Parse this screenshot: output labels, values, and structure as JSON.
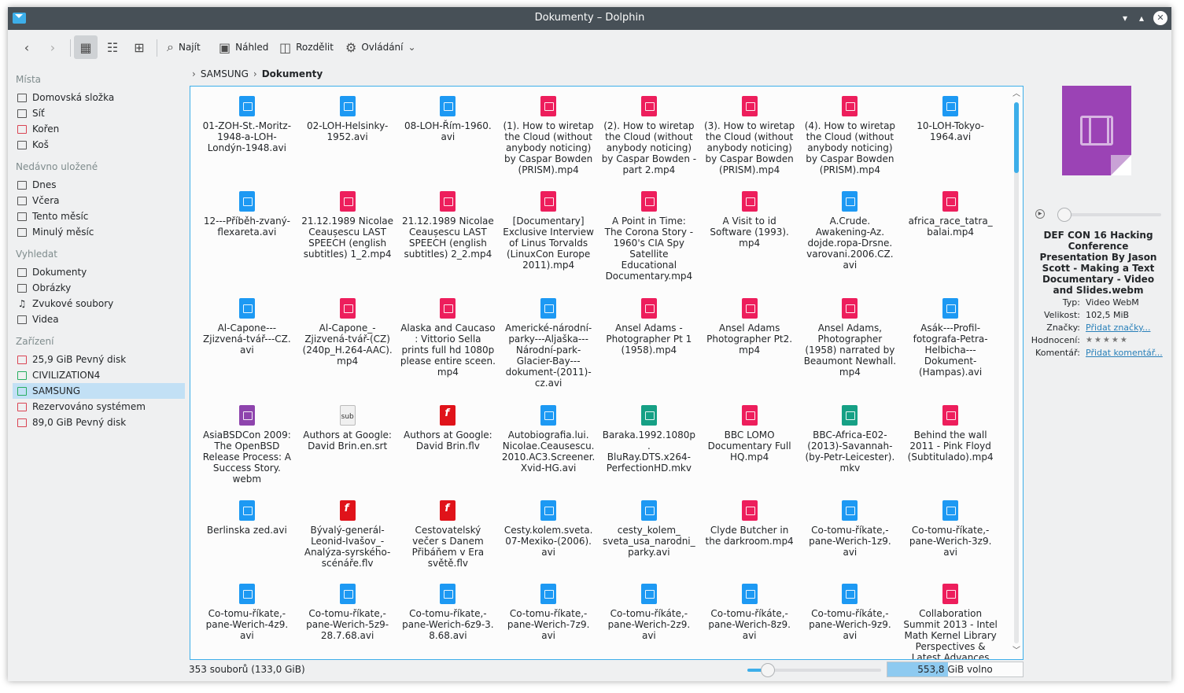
{
  "window": {
    "title": "Dokumenty – Dolphin"
  },
  "toolbar": {
    "find_label": "Najít",
    "preview_label": "Náhled",
    "split_label": "Rozdělit",
    "control_label": "Ovládání"
  },
  "sidebar": {
    "places_header": "Místa",
    "places": [
      "Domovská složka",
      "Síť",
      "Kořen",
      "Koš"
    ],
    "recent_header": "Nedávno uložené",
    "recent": [
      "Dnes",
      "Včera",
      "Tento měsíc",
      "Minulý měsíc"
    ],
    "search_header": "Vyhledat",
    "search": [
      "Dokumenty",
      "Obrázky",
      "Zvukové soubory",
      "Videa"
    ],
    "devices_header": "Zařízení",
    "devices": [
      "25,9 GiB Pevný disk",
      "CIVILIZATION4",
      "SAMSUNG",
      "Rezervováno systémem",
      "89,0 GiB Pevný disk"
    ]
  },
  "breadcrumb": {
    "root": "SAMSUNG",
    "current": "Dokumenty"
  },
  "files": [
    {
      "name": "01-ZOH-St.-Moritz-\n1948-a-LOH-\nLondýn-1948.avi",
      "color": "blue"
    },
    {
      "name": "02-LOH-Helsinky-\n1952.avi",
      "color": "blue"
    },
    {
      "name": "08-LOH-Řím-1960.\navi",
      "color": "blue"
    },
    {
      "name": "(1). How to wiretap\nthe Cloud (without\nanybody noticing)\nby Caspar Bowden\n(PRISM).mp4",
      "color": "red"
    },
    {
      "name": "(2). How to wiretap\nthe Cloud (without\nanybody noticing)\nby Caspar Bowden -\npart 2.mp4",
      "color": "red"
    },
    {
      "name": "(3). How to wiretap\nthe Cloud (without\nanybody noticing)\nby Caspar Bowden\n(PRISM).mp4",
      "color": "red"
    },
    {
      "name": "(4). How to wiretap\nthe Cloud (without\nanybody noticing)\nby Caspar Bowden\n(PRISM).mp4",
      "color": "red"
    },
    {
      "name": "10-LOH-Tokyo-\n1964.avi",
      "color": "blue"
    },
    {
      "name": "12---Příběh-zvaný-\nflexareta.avi",
      "color": "blue"
    },
    {
      "name": "21.12.1989 Nicolae\nCeaușescu LAST\nSPEECH (english\nsubtitles) 1_2.mp4",
      "color": "red"
    },
    {
      "name": "21.12.1989 Nicolae\nCeaușescu LAST\nSPEECH (english\nsubtitles) 2_2.mp4",
      "color": "red"
    },
    {
      "name": "[Documentary]\nExclusive Interview\nof Linus Torvalds\n(LinuxCon Europe\n2011).mp4",
      "color": "red"
    },
    {
      "name": "A Point in Time:\nThe Corona Story -\n1960's CIA Spy\nSatellite\nEducational\nDocumentary.mp4",
      "color": "red"
    },
    {
      "name": "A Visit to id\nSoftware (1993).\nmp4",
      "color": "red"
    },
    {
      "name": "A.Crude.\nAwakening-Az.\ndojde.ropa-Drsne.\nvarovani.2006.CZ.\navi",
      "color": "blue"
    },
    {
      "name": "africa_race_tatra_\nbalai.mp4",
      "color": "red"
    },
    {
      "name": "Al-Capone---\nZjizvená-tvář---CZ.\navi",
      "color": "blue"
    },
    {
      "name": "Al-Capone_-\nZjizvená-tvář-(CZ)\n(240p_H.264-AAC).\nmp4",
      "color": "red"
    },
    {
      "name": "Alaska and Caucaso\n: Vittorio Sella\nprints full hd 1080p\nplease entire sceen.\nmp4",
      "color": "red"
    },
    {
      "name": "Americké-národní-\nparky---Aljaška---\nNárodní-park-\nGlacier-Bay---\ndokument-(2011)-\ncz.avi",
      "color": "blue"
    },
    {
      "name": "Ansel Adams -\nPhotographer Pt 1\n(1958).mp4",
      "color": "red"
    },
    {
      "name": "Ansel Adams\nPhotographer Pt2.\nmp4",
      "color": "red"
    },
    {
      "name": "Ansel Adams,\nPhotographer\n(1958) narrated by\nBeaumont Newhall.\nmp4",
      "color": "red"
    },
    {
      "name": "Asák---Profil-\nfotografa-Petra-\nHelbicha---\nDokument-\n(Hampas).avi",
      "color": "blue"
    },
    {
      "name": "AsiaBSDCon 2009:\nThe OpenBSD\nRelease Process: A\nSuccess Story.\nwebm",
      "color": "purple"
    },
    {
      "name": "Authors at Google:\nDavid Brin.en.srt",
      "color": "sub"
    },
    {
      "name": "Authors at Google:\nDavid Brin.flv",
      "color": "flash"
    },
    {
      "name": "Autobiografia.lui.\nNicolae.Ceausescu.\n2010.AC3.Screener.\nXvid-HG.avi",
      "color": "blue"
    },
    {
      "name": "Baraka.1992.1080p.\nBluRay.DTS.x264-\nPerfectionHD.mkv",
      "color": "green"
    },
    {
      "name": "BBC LOMO\nDocumentary Full\nHQ.mp4",
      "color": "red"
    },
    {
      "name": "BBC-Africa-E02-\n(2013)-Savannah-\n(by-Petr-Leicester).\nmkv",
      "color": "green"
    },
    {
      "name": "Behind the wall\n2011 - Pink Floyd\n(Subtitulado).mp4",
      "color": "red"
    },
    {
      "name": "Berlinska zed.avi",
      "color": "blue"
    },
    {
      "name": "Bývalý-generál-\nLeonid-Ivašov_-\nAnalýza-syrského-\nscénáře.flv",
      "color": "flash"
    },
    {
      "name": "Cestovatelský\nvečer s Danem\nPřibáňem v Era\nsvětě.flv",
      "color": "flash"
    },
    {
      "name": "Cesty.kolem.sveta.\n07-Mexiko-(2006).\navi",
      "color": "blue"
    },
    {
      "name": "cesty_kolem_\nsveta_usa_narodni_\nparky.avi",
      "color": "blue"
    },
    {
      "name": "Clyde Butcher in\nthe darkroom.mp4",
      "color": "red"
    },
    {
      "name": "Co-tomu-říkate,-\npane-Werich-1z9.\navi",
      "color": "blue"
    },
    {
      "name": "Co-tomu-říkate,-\npane-Werich-3z9.\navi",
      "color": "blue"
    },
    {
      "name": "Co-tomu-říkate,-\npane-Werich-4z9.\navi",
      "color": "blue"
    },
    {
      "name": "Co-tomu-říkate,-\npane-Werich-5z9-\n28.7.68.avi",
      "color": "blue"
    },
    {
      "name": "Co-tomu-říkate,-\npane-Werich-6z9-3.\n8.68.avi",
      "color": "blue"
    },
    {
      "name": "Co-tomu-říkate,-\npane-Werich-7z9.\navi",
      "color": "blue"
    },
    {
      "name": "Co-tomu-říkáte,-\npane-Werich-2z9.\navi",
      "color": "blue"
    },
    {
      "name": "Co-tomu-říkáte,-\npane-Werich-8z9.\navi",
      "color": "blue"
    },
    {
      "name": "Co-tomu-říkáte,-\npane-Werich-9z9.\navi",
      "color": "blue"
    },
    {
      "name": "Collaboration\nSummit 2013 - Intel\nMath Kernel Library\nPerspectives &\nLatest Advances",
      "color": "red"
    }
  ],
  "info_panel": {
    "file_name": "DEF CON 16 Hacking Conference Presentation By Jason Scott - Making a Text Documentary - Video and Slides.webm",
    "type_label": "Typ:",
    "type_value": "Video WebM",
    "size_label": "Velikost:",
    "size_value": "102,5 MiB",
    "tags_label": "Značky:",
    "tags_value": "Přidat značky...",
    "rating_label": "Hodnocení:",
    "rating_value": "★★★★★",
    "comment_label": "Komentář:",
    "comment_value": "Přidat komentář..."
  },
  "status": {
    "count": "353 souborů (133,0 GiB)",
    "free": "553,8 GiB volno",
    "free_used_fraction": 0.45
  },
  "colors": {
    "accent": "#3daee9",
    "titlebar": "#475057",
    "video_blue": "#1d99f3",
    "video_red": "#ed1e5c",
    "video_purple": "#8e44ad"
  }
}
